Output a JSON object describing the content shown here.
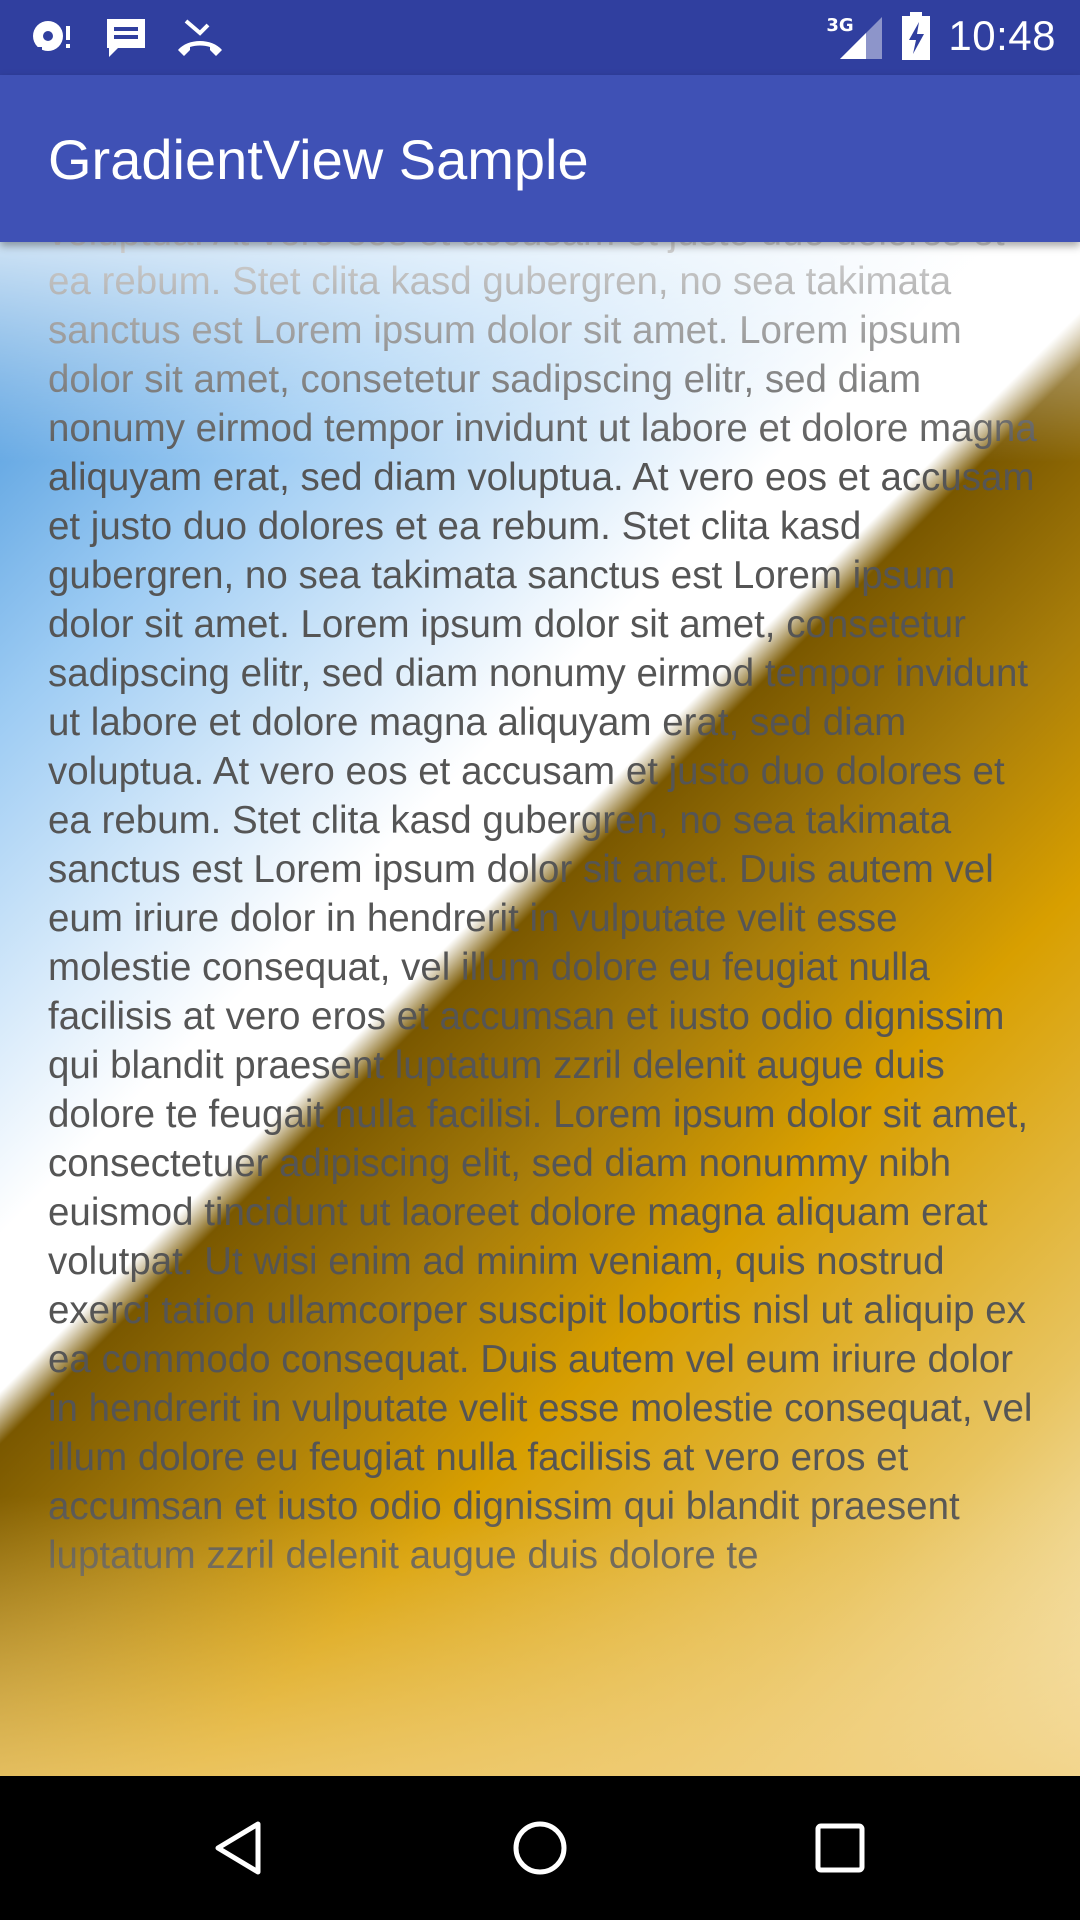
{
  "status_bar": {
    "time": "10:48",
    "network_type": "3G",
    "icons": [
      "music-notification-icon",
      "message-notification-icon",
      "missed-call-icon",
      "signal-icon",
      "battery-charging-icon"
    ]
  },
  "app_bar": {
    "title": "GradientView Sample"
  },
  "content": {
    "text": "voluptua. At vero eos et accusam et justo duo dolores et ea rebum. Stet clita kasd gubergren, no sea takimata sanctus est Lorem ipsum dolor sit amet. Lorem ipsum dolor sit amet, consetetur sadipscing elitr, sed diam nonumy eirmod tempor invidunt ut labore et dolore magna aliquyam erat, sed diam voluptua. At vero eos et accusam et justo duo dolores et ea rebum. Stet clita kasd gubergren, no sea takimata sanctus est Lorem ipsum dolor sit amet. Lorem ipsum dolor sit amet, consetetur sadipscing elitr, sed diam nonumy eirmod tempor invidunt ut labore et dolore magna aliquyam erat, sed diam voluptua. At vero eos et accusam et justo duo dolores et ea rebum. Stet clita kasd gubergren, no sea takimata sanctus est Lorem ipsum dolor sit amet. Duis autem vel eum iriure dolor in hendrerit in vulputate velit esse molestie consequat, vel illum dolore eu feugiat nulla facilisis at vero eros et accumsan et iusto odio dignissim qui blandit praesent luptatum zzril delenit augue duis dolore te feugait nulla facilisi. Lorem ipsum dolor sit amet, consectetuer adipiscing elit, sed diam nonummy nibh euismod tincidunt ut laoreet dolore magna aliquam erat volutpat. Ut wisi enim ad minim veniam, quis nostrud exerci tation ullamcorper suscipit lobortis nisl ut aliquip ex ea commodo consequat. Duis autem vel eum iriure dolor in hendrerit in vulputate velit esse molestie consequat, vel illum dolore eu feugiat nulla facilisis at vero eros et accumsan et iusto odio dignissim qui blandit praesent luptatum zzril delenit augue duis dolore te"
  },
  "nav_bar": {
    "buttons": [
      "back-icon",
      "home-icon",
      "recents-icon"
    ]
  },
  "colors": {
    "status_bar": "#303F9F",
    "app_bar": "#3F51B5",
    "gradient_start": "#3D8FD8",
    "gradient_mid": "#FFFFFF",
    "gradient_dark": "#7A5800",
    "gradient_gold": "#D89F00",
    "gradient_end": "#FBF1D4",
    "body_text": "#555555"
  }
}
